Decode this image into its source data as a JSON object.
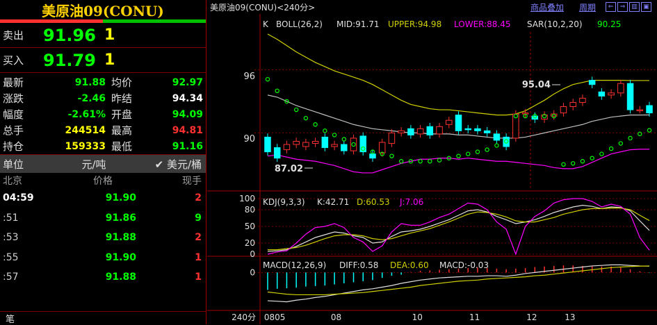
{
  "left": {
    "title": "美原油09(CONU)",
    "sell": {
      "label": "卖出",
      "price": "91.96",
      "qty": "1"
    },
    "buy": {
      "label": "买入",
      "price": "91.79",
      "qty": "1"
    },
    "stats": [
      {
        "k1": "最新",
        "v1": "91.88",
        "c1": "#00ff00",
        "k2": "均价",
        "v2": "92.97",
        "c2": "#00ff00"
      },
      {
        "k1": "涨跌",
        "v1": "-2.46",
        "c1": "#00ff00",
        "k2": "昨结",
        "v2": "94.34",
        "c2": "#ffffff"
      },
      {
        "k1": "幅度",
        "v1": "-2.61%",
        "c1": "#00ff00",
        "k2": "开盘",
        "v2": "94.09",
        "c2": "#00ff00"
      },
      {
        "k1": "总手",
        "v1": "244514",
        "c1": "#ffff00",
        "k2": "最高",
        "v2": "94.81",
        "c2": "#ff3030"
      },
      {
        "k1": "持仓",
        "v1": "159333",
        "c1": "#ffff00",
        "k2": "最低",
        "v2": "91.16",
        "c2": "#00ff00"
      }
    ],
    "unit": {
      "label": "单位",
      "cny": "元/吨",
      "usd": "✔ 美元/桶"
    },
    "ticks_header": {
      "time": "北京",
      "price": "价格",
      "qty": "现手"
    },
    "ticks": [
      {
        "time": "04:59",
        "price": "91.90",
        "qty": "2",
        "qc": "r"
      },
      {
        "time": ":51",
        "price": "91.86",
        "qty": "9",
        "qc": "g"
      },
      {
        "time": ":53",
        "price": "91.88",
        "qty": "2",
        "qc": "r"
      },
      {
        "time": ":55",
        "price": "91.90",
        "qty": "1",
        "qc": "r"
      },
      {
        "time": ":57",
        "price": "91.88",
        "qty": "1",
        "qc": "r"
      }
    ],
    "bottom_tab": "笔"
  },
  "right": {
    "chart_title": "美原油09(CONU)<240分>",
    "overlay_link": "商品叠加",
    "period_link": "周期",
    "boll": {
      "label": "K",
      "name": "BOLL(26,2)",
      "mid": "MID:91.71",
      "upper": "UPPER:94.98",
      "lower": "LOWER:88.45",
      "sar": "SAR(10,2,20)",
      "sar_val": "90.25"
    },
    "price_axis": [
      "96",
      "90"
    ],
    "annot_high": "95.04",
    "annot_low": "87.02",
    "kdj": {
      "name": "KDJ(9,3,3)",
      "k": "K:42.71",
      "d": "D:60.53",
      "j": "J:7.06",
      "axis": [
        "100",
        "80",
        "50",
        "20",
        "0"
      ]
    },
    "macd": {
      "name": "MACD(12,26,9)",
      "diff": "DIFF:0.58",
      "dea": "DEA:0.60",
      "macd": "MACD:-0.03",
      "axis": [
        "0"
      ]
    },
    "x_label_period": "240分",
    "x_labels": [
      "0805",
      "08",
      "10",
      "11",
      "12",
      "13"
    ],
    "colors": {
      "up": "#ff3030",
      "down": "#00ffff",
      "mid": "#c0c0c0",
      "upper": "#d0d000",
      "lower": "#ff00ff",
      "sar": "#00ff00"
    }
  },
  "chart_data": {
    "type": "candlestick",
    "title": "美原油09(CONU)<240分>",
    "candles": [
      {
        "o": 89.6,
        "c": 88.2
      },
      {
        "o": 88.6,
        "c": 87.6
      },
      {
        "o": 88.4,
        "c": 88.9
      },
      {
        "o": 88.9,
        "c": 89.2
      },
      {
        "o": 88.7,
        "c": 89.1
      },
      {
        "o": 89.0,
        "c": 89.2
      },
      {
        "o": 89.6,
        "c": 88.6
      },
      {
        "o": 88.7,
        "c": 88.9
      },
      {
        "o": 88.9,
        "c": 88.3
      },
      {
        "o": 88.3,
        "c": 89.5
      },
      {
        "o": 89.7,
        "c": 88.2
      },
      {
        "o": 88.0,
        "c": 87.6
      },
      {
        "o": 88.1,
        "c": 89.1
      },
      {
        "o": 89.0,
        "c": 90.0
      },
      {
        "o": 90.0,
        "c": 90.2
      },
      {
        "o": 90.4,
        "c": 89.8
      },
      {
        "o": 89.9,
        "c": 90.4
      },
      {
        "o": 90.6,
        "c": 89.8
      },
      {
        "o": 89.9,
        "c": 90.6
      },
      {
        "o": 90.8,
        "c": 91.2
      },
      {
        "o": 91.7,
        "c": 90.2
      },
      {
        "o": 90.4,
        "c": 90.3
      },
      {
        "o": 90.4,
        "c": 90.2
      },
      {
        "o": 90.2,
        "c": 90.0
      },
      {
        "o": 89.9,
        "c": 89.3
      },
      {
        "o": 89.6,
        "c": 88.7
      },
      {
        "o": 89.5,
        "c": 91.8
      },
      {
        "o": 91.8,
        "c": 91.9
      },
      {
        "o": 91.6,
        "c": 91.3
      },
      {
        "o": 91.3,
        "c": 91.7
      },
      {
        "o": 91.6,
        "c": 91.8
      },
      {
        "o": 91.9,
        "c": 92.5
      },
      {
        "o": 92.5,
        "c": 92.9
      },
      {
        "o": 92.9,
        "c": 93.3
      },
      {
        "o": 95.0,
        "c": 94.6
      },
      {
        "o": 93.9,
        "c": 93.5
      },
      {
        "o": 93.6,
        "c": 93.8
      },
      {
        "o": 93.8,
        "c": 94.7
      },
      {
        "o": 94.7,
        "c": 92.2
      },
      {
        "o": 92.2,
        "c": 92.2
      },
      {
        "o": 92.6,
        "c": 91.9
      }
    ],
    "boll_mid": [
      93.6,
      93.4,
      93.0,
      92.6,
      92.3,
      92.0,
      91.7,
      91.4,
      91.1,
      90.8,
      90.6,
      90.4,
      90.3,
      90.2,
      90.1,
      90.0,
      90.0,
      89.9,
      89.9,
      89.9,
      89.8,
      89.8,
      89.7,
      89.6,
      89.5,
      89.5,
      89.5,
      89.6,
      89.8,
      90.0,
      90.2,
      90.4,
      90.6,
      90.8,
      91.1,
      91.3,
      91.5,
      91.6,
      91.7,
      91.7,
      91.71
    ],
    "boll_upper": [
      99.4,
      98.9,
      98.3,
      97.7,
      97.2,
      96.7,
      96.3,
      95.9,
      95.6,
      95.3,
      95.0,
      94.6,
      94.1,
      93.6,
      93.1,
      92.7,
      92.5,
      92.3,
      92.2,
      92.2,
      92.1,
      92.0,
      91.9,
      91.8,
      91.7,
      91.7,
      91.8,
      92.1,
      92.6,
      93.1,
      93.7,
      94.2,
      94.6,
      94.8,
      95.0,
      95.0,
      95.0,
      95.0,
      94.98,
      94.98,
      94.98
    ],
    "boll_lower": [
      87.8,
      87.9,
      87.7,
      87.5,
      87.4,
      87.3,
      87.1,
      86.9,
      86.6,
      86.3,
      86.2,
      86.2,
      86.5,
      86.8,
      87.1,
      87.3,
      87.5,
      87.5,
      87.6,
      87.6,
      87.5,
      87.6,
      87.5,
      87.4,
      87.3,
      87.3,
      87.2,
      87.1,
      87.0,
      86.9,
      86.7,
      86.6,
      86.6,
      86.8,
      87.2,
      87.6,
      88.0,
      88.2,
      88.4,
      88.45,
      88.45
    ],
    "sar": [
      95.1,
      94.0,
      93.0,
      92.2,
      91.4,
      90.8,
      90.2,
      89.8,
      89.4,
      88.9,
      88.5,
      88.2,
      88.0,
      87.8,
      87.3,
      87.3,
      87.3,
      87.3,
      87.4,
      87.6,
      87.8,
      88.0,
      88.2,
      88.4,
      88.8,
      89.2,
      91.6,
      91.6,
      91.6,
      91.6,
      91.6,
      87.0,
      87.1,
      87.3,
      87.6,
      88.0,
      88.5,
      89.0,
      89.5,
      89.9,
      90.25
    ],
    "price_range": [
      85.6,
      99.6
    ],
    "kdj_k": [
      5,
      6,
      8,
      14,
      22,
      30,
      35,
      40,
      38,
      33,
      30,
      20,
      22,
      32,
      40,
      42,
      45,
      50,
      56,
      62,
      70,
      78,
      80,
      76,
      68,
      62,
      55,
      58,
      62,
      68,
      75,
      80,
      85,
      88,
      86,
      82,
      85,
      84,
      78,
      60,
      42.71
    ],
    "kdj_d": [
      8,
      8,
      10,
      12,
      16,
      22,
      28,
      33,
      35,
      35,
      33,
      28,
      26,
      28,
      33,
      38,
      42,
      46,
      52,
      58,
      65,
      72,
      76,
      75,
      72,
      67,
      60,
      58,
      58,
      62,
      66,
      72,
      76,
      80,
      82,
      82,
      83,
      83,
      80,
      70,
      60.53
    ],
    "kdj_j": [
      0,
      4,
      6,
      20,
      36,
      48,
      50,
      55,
      48,
      30,
      22,
      5,
      15,
      40,
      55,
      52,
      52,
      58,
      66,
      72,
      82,
      92,
      90,
      80,
      58,
      45,
      0,
      50,
      68,
      78,
      92,
      98,
      100,
      100,
      95,
      85,
      90,
      86,
      72,
      30,
      7.06
    ],
    "kdj_range": [
      -5,
      105
    ],
    "macd_hist": [
      -1.6,
      -1.5,
      -1.45,
      -1.4,
      -1.3,
      -1.25,
      -1.2,
      -1.1,
      -1.0,
      -0.9,
      -0.8,
      -0.7,
      -0.5,
      -0.3,
      -0.2,
      0.05,
      0.15,
      0.2,
      0.25,
      0.3,
      0.35,
      0.4,
      0.45,
      0.4,
      0.35,
      0.3,
      0.35,
      0.4,
      0.5,
      0.55,
      0.6,
      0.65,
      0.65,
      0.6,
      0.6,
      0.55,
      0.55,
      0.45,
      0.3,
      0.1,
      -0.03
    ],
    "macd_diff": [
      -2.6,
      -2.65,
      -2.7,
      -2.55,
      -2.45,
      -2.3,
      -2.2,
      -2.05,
      -1.9,
      -1.75,
      -1.6,
      -1.5,
      -1.35,
      -1.2,
      -1.0,
      -0.85,
      -0.7,
      -0.6,
      -0.5,
      -0.45,
      -0.4,
      -0.35,
      -0.35,
      -0.3,
      -0.3,
      -0.35,
      -0.25,
      -0.1,
      0.0,
      0.1,
      0.2,
      0.3,
      0.4,
      0.5,
      0.6,
      0.65,
      0.7,
      0.7,
      0.65,
      0.6,
      0.58
    ],
    "macd_dea": [
      -1.8,
      -1.9,
      -2.0,
      -2.05,
      -2.05,
      -2.05,
      -2.05,
      -2.0,
      -1.95,
      -1.9,
      -1.85,
      -1.75,
      -1.65,
      -1.55,
      -1.45,
      -1.35,
      -1.2,
      -1.1,
      -1.0,
      -0.9,
      -0.8,
      -0.75,
      -0.7,
      -0.6,
      -0.55,
      -0.5,
      -0.45,
      -0.4,
      -0.3,
      -0.25,
      -0.15,
      -0.05,
      0.05,
      0.15,
      0.25,
      0.35,
      0.45,
      0.5,
      0.55,
      0.58,
      0.6
    ],
    "macd_range": [
      -3.3,
      1.3
    ]
  }
}
